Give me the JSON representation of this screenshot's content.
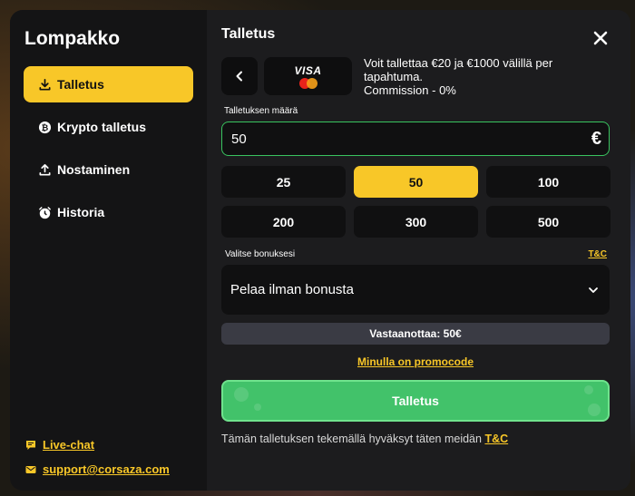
{
  "sidebar": {
    "title": "Lompakko",
    "items": [
      {
        "label": "Talletus",
        "icon": "download-icon",
        "active": true
      },
      {
        "label": "Krypto talletus",
        "icon": "bitcoin-icon",
        "active": false
      },
      {
        "label": "Nostaminen",
        "icon": "upload-icon",
        "active": false
      },
      {
        "label": "Historia",
        "icon": "alarm-clock-icon",
        "active": false
      }
    ],
    "links": {
      "live_chat": "Live-chat",
      "support_email": "support@corsaza.com"
    }
  },
  "main": {
    "title": "Talletus",
    "method": {
      "card_brand": "VISA",
      "info_line1": "Voit tallettaa €20 ja €1000 välillä per tapahtuma.",
      "info_line2": "Commission - 0%"
    },
    "amount": {
      "label": "Talletuksen määrä",
      "value": "50",
      "currency_symbol": "€"
    },
    "presets": [
      "25",
      "50",
      "100",
      "200",
      "300",
      "500"
    ],
    "selected_preset": "50",
    "bonus": {
      "label": "Valitse bonuksesi",
      "tc_label": "T&C",
      "selected": "Pelaa ilman bonusta"
    },
    "receive_text": "Vastaanottaa: 50€",
    "promo_link": "Minulla on promocode",
    "submit_label": "Talletus",
    "terms_text": "Tämän talletuksen tekemällä hyväksyt täten meidän",
    "terms_link": "T&C"
  },
  "colors": {
    "accent_yellow": "#f8c728",
    "submit_green": "#42c26a",
    "input_border_green": "#39c45f",
    "panel_dark": "#1c1c1e",
    "sidebar_dark": "#141415"
  }
}
